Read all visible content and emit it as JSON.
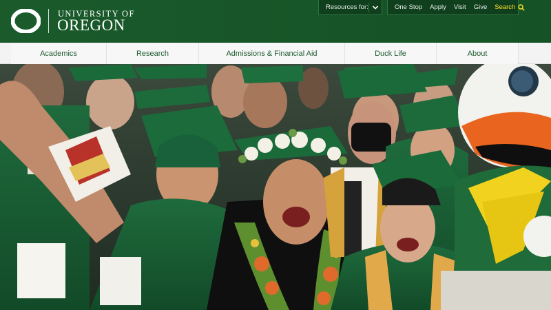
{
  "header": {
    "logo_line1": "UNIVERSITY OF",
    "logo_line2": "OREGON",
    "logo_icon": "o-logo-icon",
    "brand_green": "#154f27",
    "brand_yellow": "#fce122"
  },
  "resources": {
    "label": "Resources for:",
    "icon": "chevron-down-icon"
  },
  "utility": {
    "links": [
      "One Stop",
      "Apply",
      "Visit",
      "Give"
    ],
    "search_label": "Search",
    "search_icon": "search-icon"
  },
  "nav": {
    "items": [
      "Academics",
      "Research",
      "Admissions & Financial Aid",
      "Duck Life",
      "About"
    ]
  },
  "hero": {
    "image": "graduates-celebrating-photo"
  }
}
